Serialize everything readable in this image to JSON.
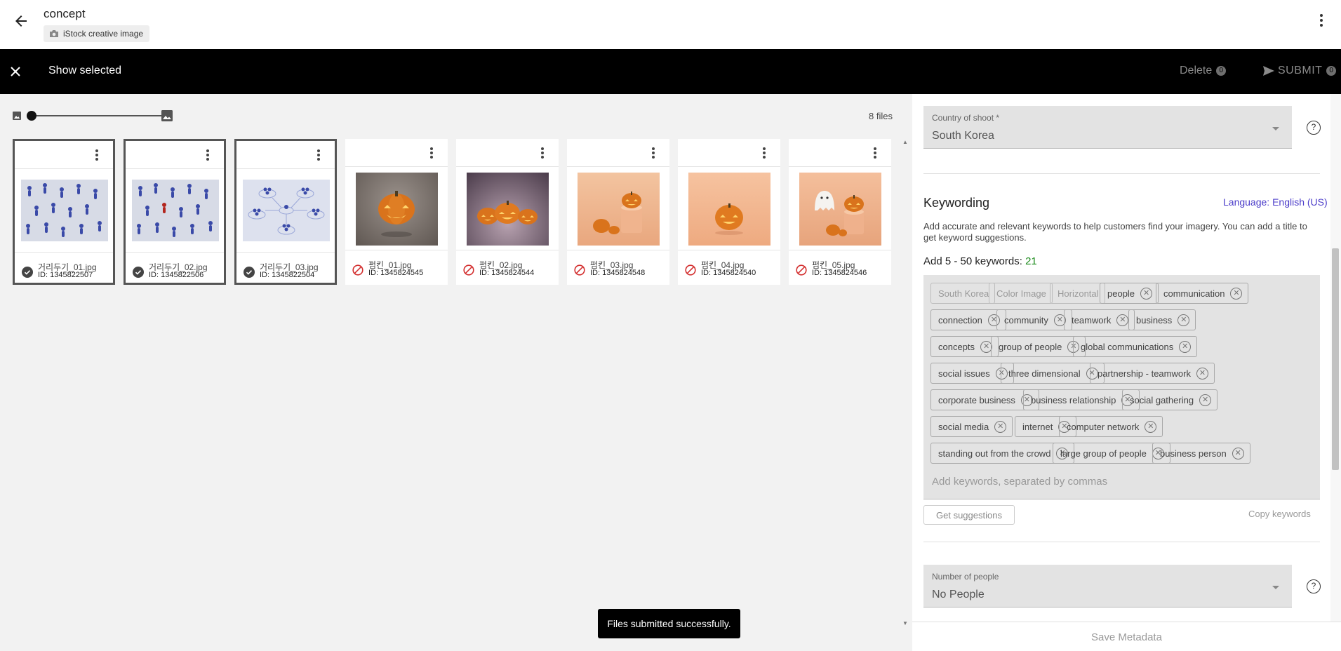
{
  "header": {
    "title": "concept",
    "source_chip": "iStock creative image"
  },
  "action_bar": {
    "show_selected": "Show selected",
    "delete_label": "Delete",
    "delete_count": "0",
    "submit_label": "SUBMIT",
    "submit_count": "0"
  },
  "gallery": {
    "file_count": "8 files",
    "files": [
      {
        "name": "거리두기_01.jpg",
        "id": "ID: 1345822507",
        "status": "submitted",
        "selected": true,
        "image": "people-crowd-red-none"
      },
      {
        "name": "거리두기_02.jpg",
        "id": "ID: 1345822506",
        "status": "submitted",
        "selected": true,
        "image": "people-crowd-red-one"
      },
      {
        "name": "거리두기_03.jpg",
        "id": "ID: 1345822504",
        "status": "submitted",
        "selected": true,
        "image": "people-network"
      },
      {
        "name": "펌킨_01.jpg",
        "id": "ID: 1345824545",
        "status": "not-submitted",
        "selected": false,
        "image": "pumpkin-single"
      },
      {
        "name": "펌킨_02.jpg",
        "id": "ID: 1345824544",
        "status": "not-submitted",
        "selected": false,
        "image": "pumpkins-three"
      },
      {
        "name": "펌킨_03.jpg",
        "id": "ID: 1345824548",
        "status": "not-submitted",
        "selected": false,
        "image": "pumpkins-cylinder"
      },
      {
        "name": "펌킨_04.jpg",
        "id": "ID: 1345824540",
        "status": "not-submitted",
        "selected": false,
        "image": "pumpkin-peach"
      },
      {
        "name": "펌킨_05.jpg",
        "id": "ID: 1345824546",
        "status": "not-submitted",
        "selected": false,
        "image": "ghost-pumpkins"
      }
    ]
  },
  "toast": {
    "message": "Files submitted successfully."
  },
  "metadata": {
    "country": {
      "label": "Country of shoot *",
      "value": "South Korea"
    },
    "keywording": {
      "title": "Keywording",
      "language": "Language: English (US)",
      "description": "Add accurate and relevant keywords to help customers find your imagery. You can add a title to get keyword suggestions.",
      "count_prefix": "Add 5 - 50 keywords:",
      "count": "21",
      "fixed_keywords": [
        "South Korea",
        "Color Image",
        "Horizontal"
      ],
      "keywords": [
        "people",
        "communication",
        "connection",
        "community",
        "teamwork",
        "business",
        "concepts",
        "group of people",
        "global communications",
        "social issues",
        "three dimensional",
        "partnership - teamwork",
        "corporate business",
        "business relationship",
        "social gathering",
        "social media",
        "internet",
        "computer network",
        "standing out from the crowd",
        "large group of people",
        "business person"
      ],
      "input_placeholder": "Add keywords, separated by commas",
      "get_suggestions": "Get suggestions",
      "copy_keywords": "Copy keywords"
    },
    "people": {
      "label": "Number of people",
      "value": "No People"
    },
    "save": "Save Metadata"
  },
  "colors": {
    "accent_link": "#4a3bc9",
    "count_green": "#1b8a1b",
    "not_submitted_red": "#d32f2f"
  }
}
